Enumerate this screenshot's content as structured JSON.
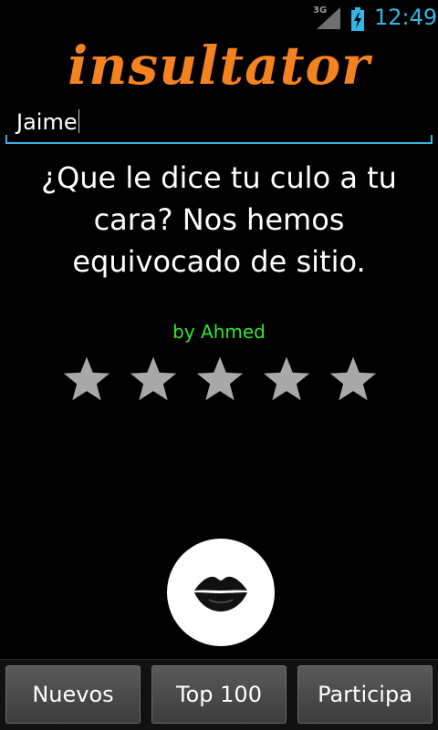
{
  "status_bar": {
    "network": "3G",
    "time": "12:49"
  },
  "app": {
    "logo_text": "insultator"
  },
  "name_field": {
    "value": "Jaime"
  },
  "insult": {
    "text": "¿Que le dice tu culo a tu cara? Nos hemos equivocado de sitio.",
    "author": "by Ahmed",
    "rating_max": 5,
    "rating": 0
  },
  "kiss_button": {
    "icon": "lips-icon"
  },
  "tabs": [
    {
      "label": "Nuevos"
    },
    {
      "label": "Top 100"
    },
    {
      "label": "Participa"
    }
  ],
  "colors": {
    "accent": "#33b5e5",
    "logo": "#f58220",
    "author": "#2ee82e",
    "star": "#a8a8a8"
  }
}
